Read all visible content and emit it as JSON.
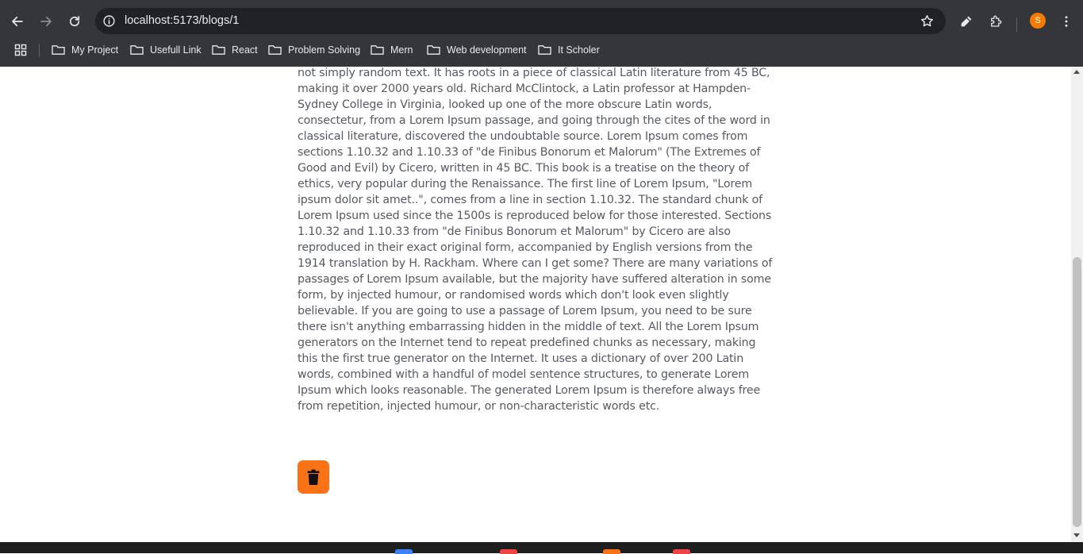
{
  "browser": {
    "url": "localhost:5173/blogs/1",
    "profile_initial": "S",
    "accent_color": "#f57c00",
    "icons": [
      "back-icon",
      "forward-icon",
      "reload-icon",
      "site-info-icon",
      "bookmark-star-icon",
      "pen-icon",
      "extensions-icon",
      "menu-icon",
      "apps-icon",
      "folder-icon"
    ]
  },
  "bookmarks": [
    {
      "label": "My Project"
    },
    {
      "label": "Usefull Link"
    },
    {
      "label": "React"
    },
    {
      "label": "Problem Solving"
    },
    {
      "label": "Mern"
    },
    {
      "label": "Web development"
    },
    {
      "label": "It Scholer"
    }
  ],
  "article": {
    "body": "not simply random text. It has roots in a piece of classical Latin literature from 45 BC, making it over 2000 years old. Richard McClintock, a Latin professor at Hampden-Sydney College in Virginia, looked up one of the more obscure Latin words, consectetur, from a Lorem Ipsum passage, and going through the cites of the word in classical literature, discovered the undoubtable source. Lorem Ipsum comes from sections 1.10.32 and 1.10.33 of \"de Finibus Bonorum et Malorum\" (The Extremes of Good and Evil) by Cicero, written in 45 BC. This book is a treatise on the theory of ethics, very popular during the Renaissance. The first line of Lorem Ipsum, \"Lorem ipsum dolor sit amet..\", comes from a line in section 1.10.32. The standard chunk of Lorem Ipsum used since the 1500s is reproduced below for those interested. Sections 1.10.32 and 1.10.33 from \"de Finibus Bonorum et Malorum\" by Cicero are also reproduced in their exact original form, accompanied by English versions from the 1914 translation by H. Rackham. Where can I get some? There are many variations of passages of Lorem Ipsum available, but the majority have suffered alteration in some form, by injected humour, or randomised words which don't look even slightly believable. If you are going to use a passage of Lorem Ipsum, you need to be sure there isn't anything embarrassing hidden in the middle of text. All the Lorem Ipsum generators on the Internet tend to repeat predefined chunks as necessary, making this the first true generator on the Internet. It uses a dictionary of over 200 Latin words, combined with a handful of model sentence structures, to generate Lorem Ipsum which looks reasonable. The generated Lorem Ipsum is therefore always free from repetition, injected humour, or non-characteristic words etc.",
    "delete_icon": "trash-icon",
    "delete_color": "#f97316"
  }
}
